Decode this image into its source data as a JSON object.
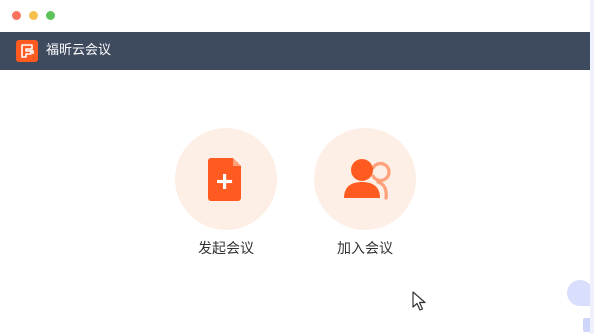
{
  "window": {
    "title_controls": [
      "close",
      "minimize",
      "maximize"
    ]
  },
  "header": {
    "logo_icon": "app-logo-icon",
    "title": "福昕云会议",
    "background": "#3e4a5e"
  },
  "actions": [
    {
      "id": "start-meeting",
      "label": "发起会议",
      "icon": "file-plus-icon"
    },
    {
      "id": "join-meeting",
      "label": "加入会议",
      "icon": "users-icon"
    }
  ],
  "colors": {
    "accent": "#ff5a1f",
    "accent_light": "#ffa07a",
    "circle_bg": "#fdeee6"
  }
}
